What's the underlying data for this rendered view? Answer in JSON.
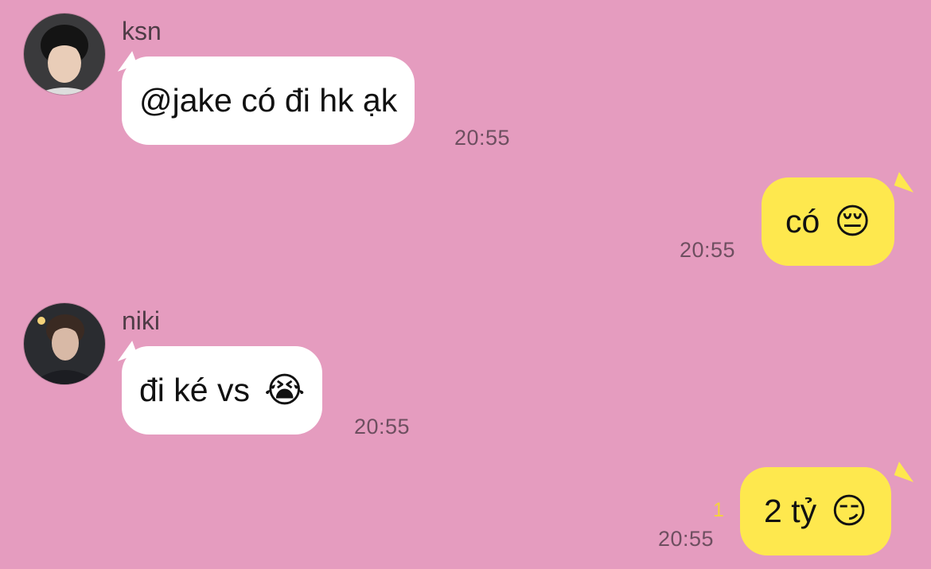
{
  "messages": [
    {
      "sender": "ksn",
      "text": "@jake có đi hk ạk",
      "time": "20:55",
      "direction": "incoming",
      "avatar": "ksn-avatar"
    },
    {
      "text": "có",
      "emoji": "😔",
      "time": "20:55",
      "direction": "outgoing"
    },
    {
      "sender": "niki",
      "text": "đi ké vs",
      "emoji": "😭",
      "time": "20:55",
      "direction": "incoming",
      "avatar": "niki-avatar"
    },
    {
      "text": "2 tỷ",
      "emoji": "😏",
      "time": "20:55",
      "unread_count": "1",
      "direction": "outgoing"
    }
  ],
  "colors": {
    "background": "#e59cbf",
    "incoming_bubble": "#ffffff",
    "outgoing_bubble": "#fee84e",
    "timestamp": "#6e4f60",
    "unread": "#f5d23c"
  }
}
